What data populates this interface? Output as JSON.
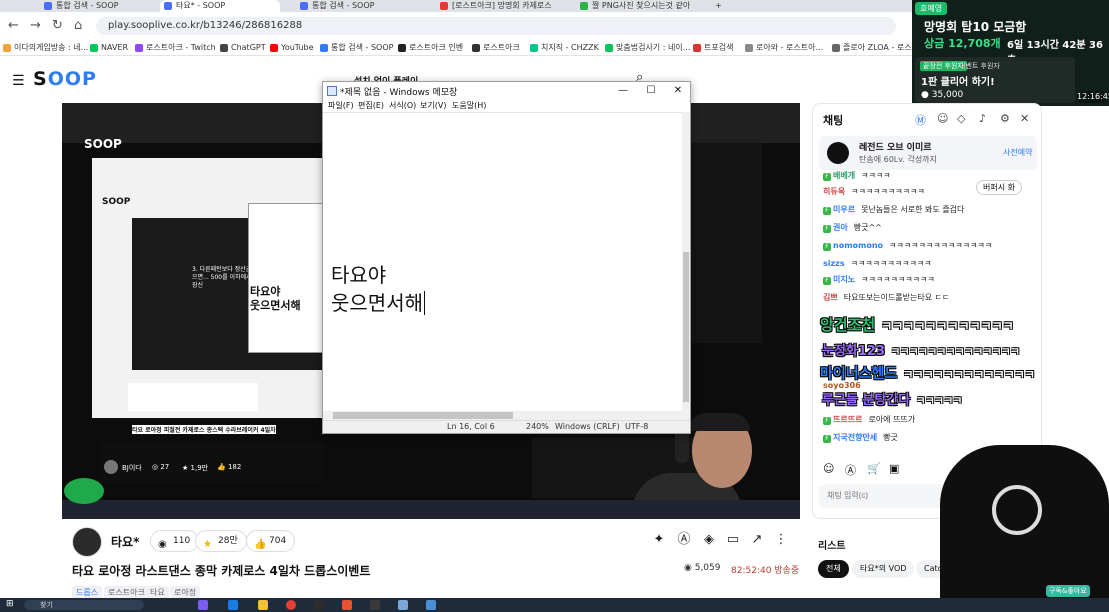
{
  "browser": {
    "tabs": [
      "통합 검색 - SOOP",
      "타요* - SOOP",
      "통합 검색 - SOOP",
      "[로스트아크] 망명회 카제로스",
      "짤 PNG사진 찾으시는것 같아"
    ],
    "url": "play.sooplive.co.kr/b13246/286816288",
    "bookmarks": [
      "이다의게임방송 : 네...",
      "NAVER",
      "로스트아크 - Twitch",
      "ChatGPT",
      "YouTube",
      "통합 검색 - SOOP",
      "로스트아크 인벤",
      "로스트아크",
      "치지직 - CHZZK",
      "맞춤법검사기 : 네이...",
      "트포검색",
      "로아와 - 로스트아...",
      "즐로아 ZLOA - 로스..."
    ]
  },
  "widget": {
    "chip": "호예영",
    "title": "망명회 탑10 모금함",
    "amount": "상금 12,708개",
    "timer": "6일 13시간 42분 36초",
    "panel_mini": "끝장전 후원자",
    "panel_mini2": "이벤트 후원자",
    "panel_msg": "1판 클리어 하기!",
    "coins": "35,000",
    "live_time": "12:16:45"
  },
  "soop": {
    "logo_main": "S",
    "logo_accent": "OOP",
    "search_hint": "설치 없이 플레이"
  },
  "notepad": {
    "title": "*제목 없음 - Windows 메모장",
    "menus": [
      "파일(F)",
      "편집(E)",
      "서식(O)",
      "보기(V)",
      "도움말(H)"
    ],
    "lines": [
      "타요야",
      "웃으면서해"
    ],
    "status": {
      "position": "Ln 16, Col 6",
      "zoom": "240%",
      "line_ending": "Windows (CRLF)",
      "encoding": "UTF-8"
    }
  },
  "nested": {
    "line1": "타요야",
    "line2": "웃으면서해",
    "caption": "3. 다른패턴보다 정산금있으면... 500를 이하에서 클장신",
    "bottom_title": "타요 로아정 피절전 카제로스 종스택 수라브레이커 4일차",
    "bottom_user": "BJ이다",
    "likes": "27",
    "stars": "1,9만",
    "thumbs": "182"
  },
  "stream": {
    "name": "타요*",
    "viewers_pill": "110",
    "stars_pill": "28만",
    "likes_pill": "704",
    "title": "타요 로아정 라스트댄스 종막 카제로스 4일차 드롭스이벤트",
    "tags": [
      "드롭스",
      "로스트아크",
      "타요",
      "로아정"
    ],
    "viewers": "5,059",
    "uptime": "82:52:40 방송중"
  },
  "chat": {
    "title": "채팅",
    "notice": {
      "title": "레전드 오브 이미르",
      "subtitle": "탄솜에 60Lv. 각성까지",
      "action": "사전예약"
    },
    "lang_chip": "버퍼시 화",
    "lines": [
      {
        "nick": "배베개",
        "msg": "ㅋㅋㅋㅋ",
        "color": "#2e9f6a",
        "badge": true
      },
      {
        "nick": "히듀욱",
        "msg": "ㅋㅋㅋㅋㅋㅋㅋㅋㅋㅋ",
        "color": "#d14a4a",
        "badge": false
      },
      {
        "nick": "미우르",
        "msg": "못난놈들은 서로한 봐도 즐겁다",
        "color": "#2e7cf6",
        "badge": true
      },
      {
        "nick": "권아",
        "msg": "빵긋^^",
        "color": "#2e7cf6",
        "badge": true
      },
      {
        "nick": "nomomono",
        "msg": "ㅋㅋㅋㅋㅋㅋㅋㅋㅋㅋㅋㅋㅋㅋ",
        "color": "#2e7cf6",
        "badge": true
      },
      {
        "nick": "sizzs",
        "msg": "ㅋㅋㅋㅋㅋㅋㅋㅋㅋㅋㅋ",
        "color": "#2e7cf6",
        "badge": false
      },
      {
        "nick": "미지노",
        "msg": "ㅋㅋㅋㅋㅋㅋㅋㅋㅋㅋ",
        "color": "#2e7cf6",
        "badge": true
      },
      {
        "nick": "김쁘",
        "msg": "타요또보는이드롤받는타요 ㄷㄷ",
        "color": "#d14a4a",
        "badge": false
      },
      {
        "nick": "soyo306",
        "msg": "",
        "color": "#b3541e",
        "badge": false
      },
      {
        "nick": "뜨르뜨르",
        "msg": "로아에 뜨뜨가",
        "color": "#d14a4a",
        "badge": true
      },
      {
        "nick": "지국전향만세",
        "msg": "빵긋",
        "color": "#2e7cf6",
        "badge": true
      }
    ],
    "input_placeholder": "채팅 입력(c)"
  },
  "overlay_chat": [
    {
      "nick": "앙건조천",
      "msg": "ㅋㅋㅋㅋㅋㅋㅋㅋㅋㅋㅋㅋ",
      "nick_color": "#2fbf71"
    },
    {
      "nick": "눈정화123",
      "msg": "ㅋㅋㅋㅋㅋㅋㅋㅋㅋㅋㅋㅋㅋㅋ",
      "nick_color": "#9b6cf6"
    },
    {
      "nick": "마이너스헨드",
      "msg": "ㅋㅋㅋㅋㅋㅋㅋㅋㅋㅋㅋㅋㅋ",
      "nick_color": "#2e7cf6"
    },
    {
      "nick": "루근들 분탕간다",
      "msg": "ㅋㅋㅋㅋㅋ",
      "nick_color": "#9b6cf6"
    }
  ],
  "list": {
    "title": "리스트",
    "tabs": [
      "전체",
      "타요*의 VOD",
      "Catch"
    ]
  },
  "chair_tag": "구독&좋아요",
  "taskbar": {
    "search": "찾기"
  },
  "colors": {
    "soop_blue": "#2e7cf6",
    "widget_bg": "#101f19",
    "live_red": "#c23d3d"
  }
}
